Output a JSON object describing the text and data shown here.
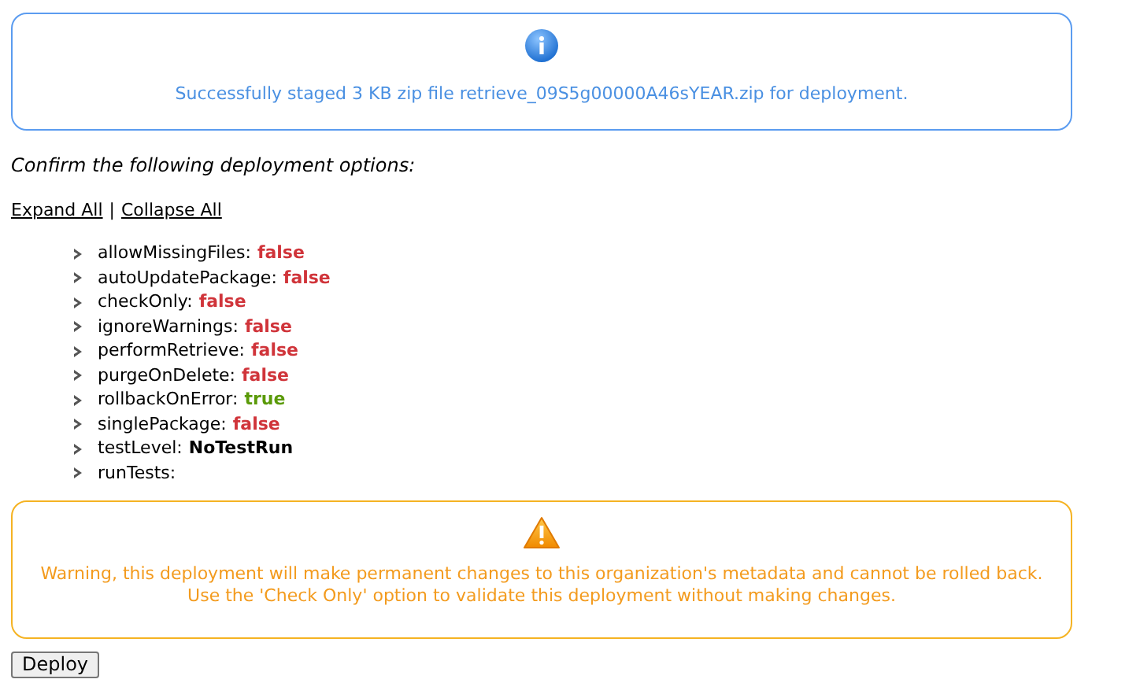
{
  "info_message": "Successfully staged 3 KB zip file retrieve_09S5g00000A46sYEAR.zip for deployment.",
  "prompt": "Confirm the following deployment options:",
  "links": [
    {
      "label": "Expand All"
    },
    {
      "label": "Collapse All"
    }
  ],
  "separator": "|",
  "options": [
    {
      "name": "allowMissingFiles:",
      "value": "false",
      "kind": "negative"
    },
    {
      "name": "autoUpdatePackage:",
      "value": "false",
      "kind": "negative"
    },
    {
      "name": "checkOnly:",
      "value": "false",
      "kind": "negative"
    },
    {
      "name": "ignoreWarnings:",
      "value": "false",
      "kind": "negative"
    },
    {
      "name": "performRetrieve:",
      "value": "false",
      "kind": "negative"
    },
    {
      "name": "purgeOnDelete:",
      "value": "false",
      "kind": "negative"
    },
    {
      "name": "rollbackOnError:",
      "value": "true",
      "kind": "positive"
    },
    {
      "name": "singlePackage:",
      "value": "false",
      "kind": "negative"
    },
    {
      "name": "testLevel:",
      "value": "NoTestRun",
      "kind": "plain"
    },
    {
      "name": "runTests:",
      "kind": "empty"
    }
  ],
  "warning_message": "Warning, this deployment will make permanent changes to this organization's metadata and cannot be rolled back. Use the 'Check Only' option to validate this deployment without making changes.",
  "deploy_button": "Deploy"
}
